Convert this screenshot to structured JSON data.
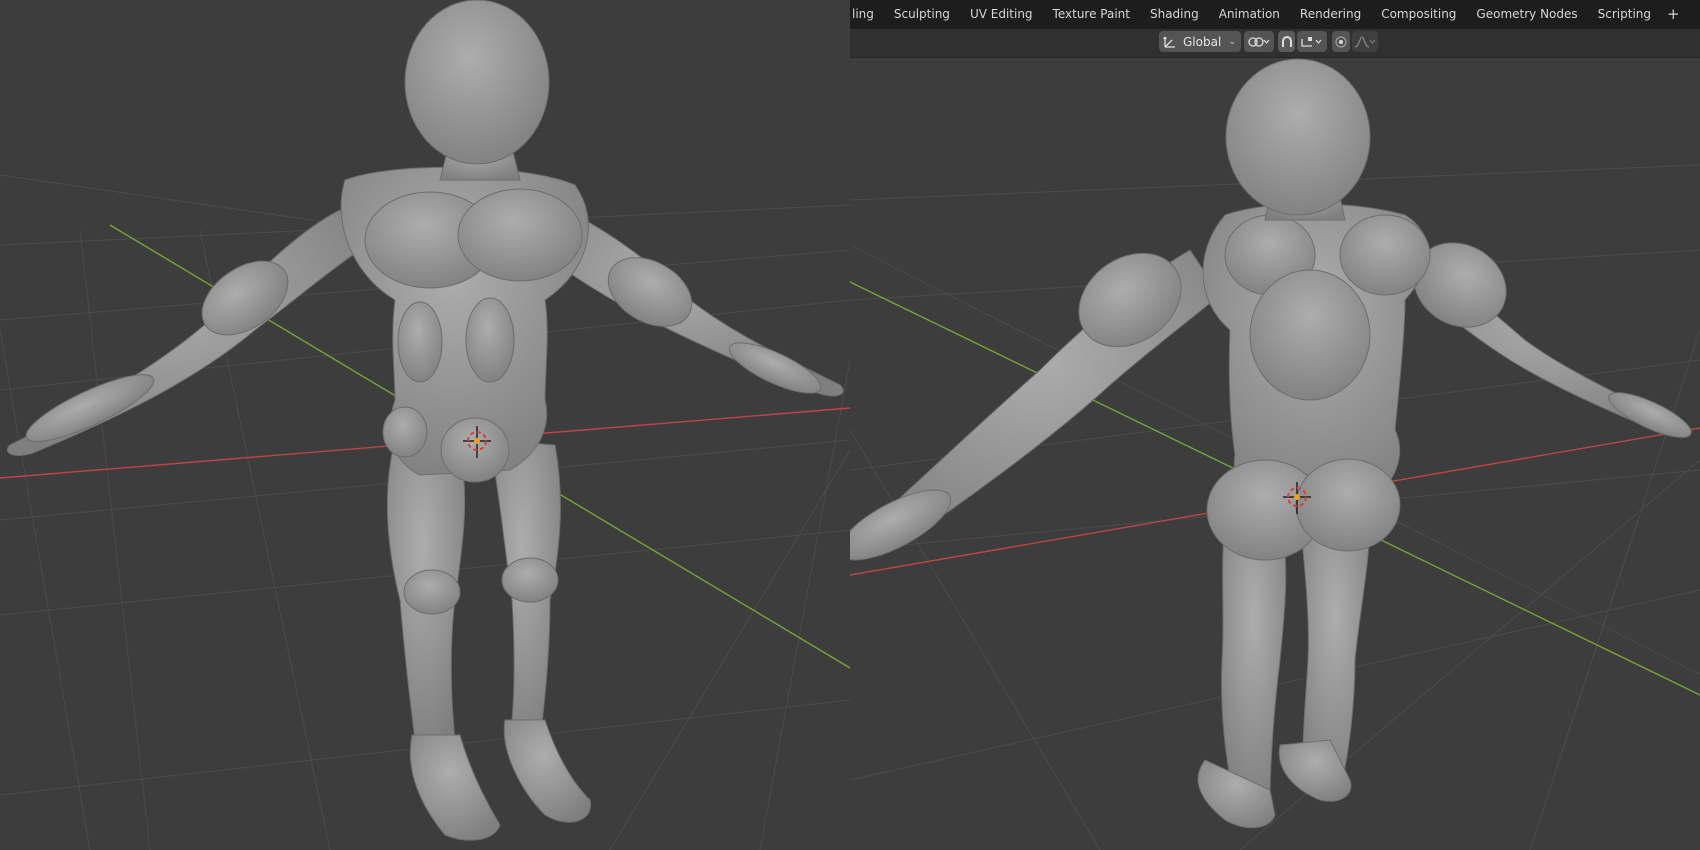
{
  "workspace_tabs": [
    "ling",
    "Sculpting",
    "UV Editing",
    "Texture Paint",
    "Shading",
    "Animation",
    "Rendering",
    "Compositing",
    "Geometry Nodes",
    "Scripting"
  ],
  "add_workspace_label": "+",
  "header": {
    "transform_orientation": "Global",
    "pivot_icon": "transform-orientation-icon",
    "snap_icon": "magnet-snap-icon",
    "snap_target_icon": "snap-target-icon",
    "proportional_icon": "proportional-editing-icon",
    "falloff_icon": "falloff-curve-icon",
    "link_icon": "pivot-link-icon",
    "dropdown_icon": "chevron-down-icon"
  },
  "colors": {
    "viewport_bg": "#3d3d3d",
    "grid_line": "#4a4a4a",
    "x_axis": "#c04545",
    "y_axis": "#7aa23a",
    "mesh": "#9c9c9c",
    "tab_bar": "#1d1d1d",
    "header": "#303030"
  },
  "viewports": [
    {
      "name": "left-viewport",
      "view": "front",
      "origin_icon": "object-origin-icon"
    },
    {
      "name": "right-viewport",
      "view": "back",
      "origin_icon": "object-origin-icon"
    }
  ]
}
